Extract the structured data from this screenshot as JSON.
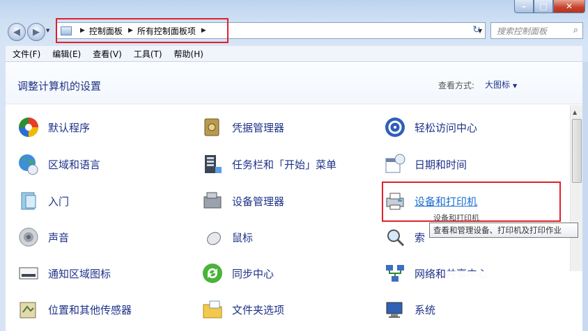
{
  "window": {
    "caption": {
      "minimize": "–",
      "maximize": "□",
      "close": "✕"
    }
  },
  "nav": {
    "back": "◀",
    "forward": "▶",
    "history": "▼",
    "breadcrumb": [
      "控制面板",
      "所有控制面板项"
    ],
    "address_dropdown": "▼",
    "refresh": "↻",
    "search_placeholder": "搜索控制面板",
    "search_icon": "🔍"
  },
  "menu": [
    "文件(F)",
    "编辑(E)",
    "查看(V)",
    "工具(T)",
    "帮助(H)"
  ],
  "header": {
    "title": "调整计算机的设置",
    "view_label": "查看方式:",
    "view_value": "大图标",
    "view_caret": "▼"
  },
  "items": {
    "col1": [
      "默认程序",
      "区域和语言",
      "入门",
      "声音",
      "通知区域图标",
      "位置和其他传感器"
    ],
    "col2": [
      "凭据管理器",
      "任务栏和「开始」菜单",
      "设备管理器",
      "鼠标",
      "同步中心",
      "文件夹选项"
    ],
    "col3": [
      "轻松访问中心",
      "日期和时间",
      "设备和打印机",
      "索引选项",
      "网络和共享中心",
      "系统"
    ]
  },
  "col3_visible": [
    "轻松访问中心",
    "日期和时间",
    "设备和打印机",
    "索",
    "网络和共享中心",
    "系统"
  ],
  "tooltip": {
    "behind": "设备和打印机",
    "text": "查看和管理设备、打印机及打印作业"
  },
  "colors": {
    "link": "#1e3287",
    "highlight": "#e0202a"
  }
}
